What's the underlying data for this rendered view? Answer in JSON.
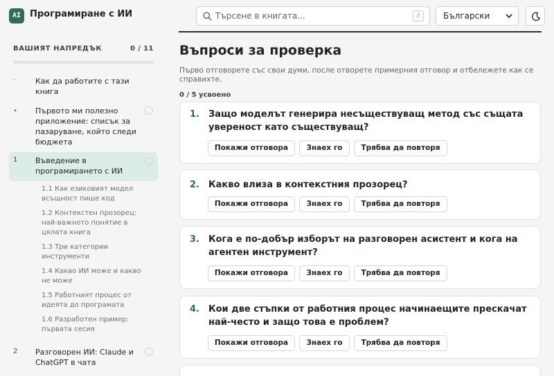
{
  "header": {
    "logo_text": "AI",
    "app_title": "Програмиране с ИИ",
    "search_placeholder": "Търсене в книгата...",
    "search_shortcut": "/",
    "language": "Български",
    "theme_icon": "moon-icon"
  },
  "sidebar": {
    "progress_title": "ВАШИЯТ НАПРЕДЪК",
    "progress_count": "0 / 11",
    "progress_fraction": 0,
    "chapters": [
      {
        "num": "·",
        "label": "Как да работите с тази книга",
        "has_check": false
      },
      {
        "num": "⋆",
        "label": "Първото ми полезно приложение: списък за пазаруване, който следи бюджета",
        "has_check": true
      },
      {
        "num": "1",
        "label": "Въведение в програмирането с ИИ",
        "has_check": true,
        "active": true
      },
      {
        "num": "2",
        "label": "Разговорен ИИ: Claude и ChatGPT в чата",
        "has_check": true
      }
    ],
    "sections": [
      "1.1  Как езиковият модел всъщност пише код",
      "1.2  Контекстен прозорец: най-важното понятие в цялата книга",
      "1.3  Три категории инструменти",
      "1.4  Какво ИИ може и какво не може",
      "1.5  Работният процес от идеята до програмата",
      "1.6  Разработен пример: първата сесия"
    ]
  },
  "main": {
    "title": "Въпроси за проверка",
    "description": "Първо отговорете със свои думи, после отворете примерния отговор и отбележете как се справихте.",
    "learned": "0 / 5 усвоено",
    "buttons": {
      "show": "Покажи отговора",
      "know": "Знаех го",
      "repeat": "Трябва да повторя"
    },
    "questions": [
      {
        "num": "1.",
        "text": "Защо моделът генерира несъществуващ метод със същата увереност като съществуващ?"
      },
      {
        "num": "2.",
        "text": "Какво влиза в контекстния прозорец?"
      },
      {
        "num": "3.",
        "text": "Кога е по-добър изборът на разговорен асистент и кога на агентен инструмент?"
      },
      {
        "num": "4.",
        "text": "Кои две стъпки от работния процес начинаещите прескачат най-често и защо това е проблем?"
      }
    ]
  }
}
